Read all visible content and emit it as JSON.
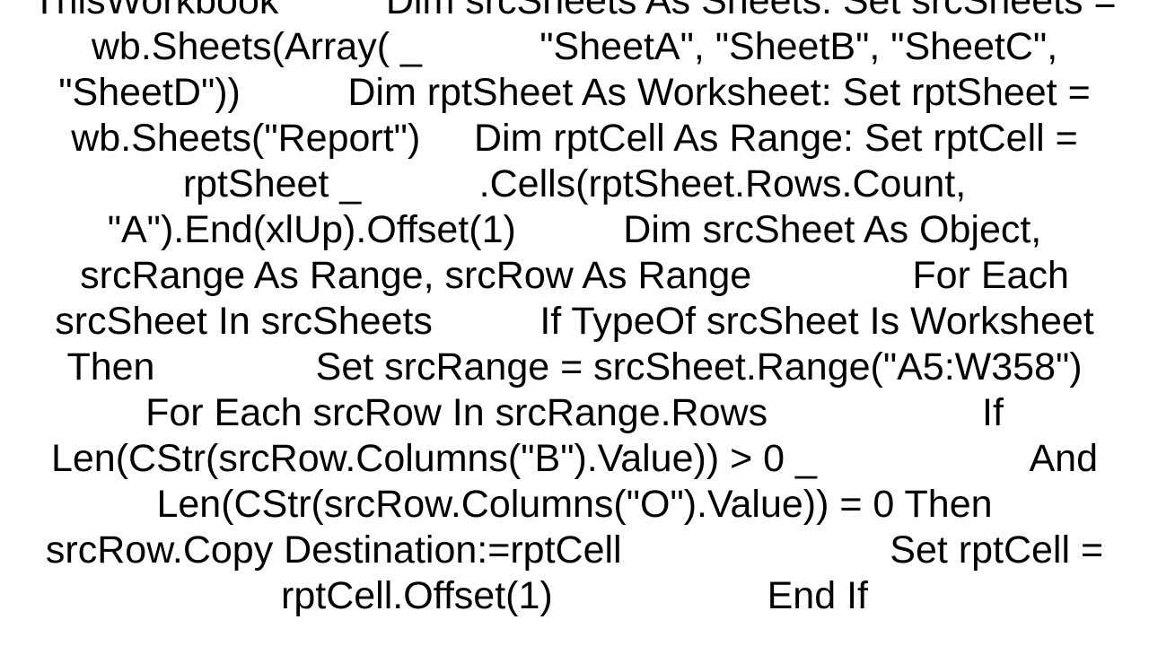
{
  "code_text": "ThisWorkbook          Dim srcSheets As Sheets: Set srcSheets = wb.Sheets(Array( _           \"SheetA\", \"SheetB\", \"SheetC\", \"SheetD\"))          Dim rptSheet As Worksheet: Set rptSheet = wb.Sheets(\"Report\")     Dim rptCell As Range: Set rptCell = rptSheet _           .Cells(rptSheet.Rows.Count, \"A\").End(xlUp).Offset(1)          Dim srcSheet As Object, srcRange As Range, srcRow As Range               For Each srcSheet In srcSheets          If TypeOf srcSheet Is Worksheet Then               Set srcRange = srcSheet.Range(\"A5:W358\")               For Each srcRow In srcRange.Rows                    If Len(CStr(srcRow.Columns(\"B\").Value)) > 0 _                    And Len(CStr(srcRow.Columns(\"O\").Value)) = 0 Then                         srcRow.Copy Destination:=rptCell                         Set rptCell = rptCell.Offset(1)                    End If"
}
